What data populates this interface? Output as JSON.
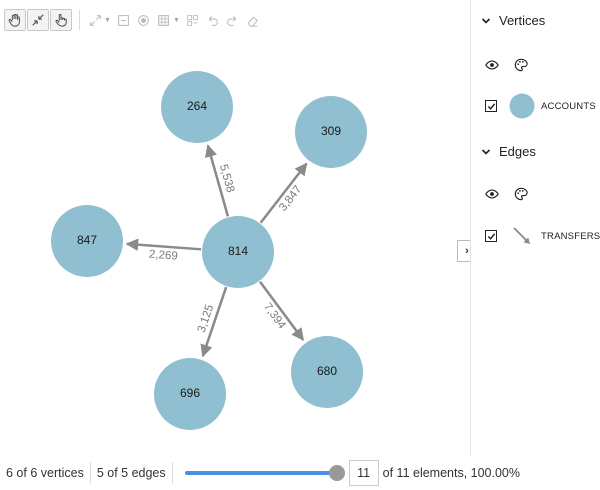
{
  "toolbar": {
    "buttons": [
      {
        "name": "pan-icon"
      },
      {
        "name": "shrink-icon"
      },
      {
        "name": "select-hand-icon"
      }
    ],
    "ghost_buttons": [
      {
        "name": "expand-icon"
      },
      {
        "name": "minimize-icon"
      },
      {
        "name": "circle-icon"
      },
      {
        "name": "grid-icon"
      },
      {
        "name": "layout-icon"
      },
      {
        "name": "undo-icon"
      },
      {
        "name": "redo-icon"
      },
      {
        "name": "eraser-icon"
      }
    ]
  },
  "graph": {
    "nodes": [
      {
        "id": "814",
        "label": "814",
        "center": true
      },
      {
        "id": "264",
        "label": "264"
      },
      {
        "id": "309",
        "label": "309"
      },
      {
        "id": "847",
        "label": "847"
      },
      {
        "id": "696",
        "label": "696"
      },
      {
        "id": "680",
        "label": "680"
      }
    ],
    "edges": [
      {
        "from": "814",
        "to": "264",
        "label": "5,538"
      },
      {
        "from": "814",
        "to": "309",
        "label": "3,847"
      },
      {
        "from": "814",
        "to": "847",
        "label": "2,269"
      },
      {
        "from": "814",
        "to": "696",
        "label": "3,125"
      },
      {
        "from": "814",
        "to": "680",
        "label": "7,394"
      }
    ],
    "node_color": "#8fbfd0",
    "edge_color": "#8a8a8a"
  },
  "legend": {
    "vertices_header": "Vertices",
    "vertices_item": "ACCOUNTS",
    "edges_header": "Edges",
    "edges_item": "TRANSFERS",
    "toggle_label": "›"
  },
  "status": {
    "vertices_text": "6 of 6 vertices",
    "edges_text": "5 of 5 edges",
    "slider_percent": 100,
    "count_value": "11",
    "elements_text": "of 11 elements, 100.00%",
    "accent_color": "#4a90e2"
  }
}
